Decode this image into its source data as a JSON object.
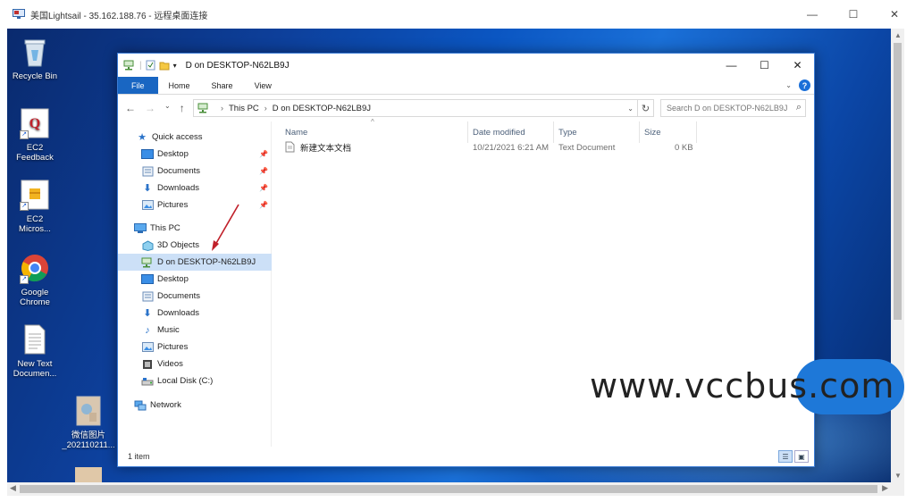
{
  "rdp": {
    "title": "美国Lightsail - 35.162.188.76 - 远程桌面连接",
    "minimize": "—",
    "maximize": "☐",
    "close": "✕"
  },
  "desktop_icons": [
    {
      "label_lines": [
        "Recycle Bin"
      ],
      "icon": "recycle-bin-icon"
    },
    {
      "label_lines": [
        "EC2",
        "Feedback"
      ],
      "icon": "feedback-icon"
    },
    {
      "label_lines": [
        "EC2",
        "Micros..."
      ],
      "icon": "package-icon"
    },
    {
      "label_lines": [
        "Google",
        "Chrome"
      ],
      "icon": "chrome-icon"
    },
    {
      "label_lines": [
        "New Text",
        "Documen..."
      ],
      "icon": "text-document-icon"
    },
    {
      "label_lines": [
        "微信图片",
        "_202110211..."
      ],
      "icon": "image-file-icon"
    }
  ],
  "explorer": {
    "title": "D on DESKTOP-N62LB9J",
    "ribbon_tabs": [
      "File",
      "Home",
      "Share",
      "View"
    ],
    "address": {
      "segments": [
        "This PC",
        "D on DESKTOP-N62LB9J"
      ]
    },
    "search_placeholder": "Search D on DESKTOP-N62LB9J",
    "nav": {
      "quick_access": "Quick access",
      "quick_items": [
        "Desktop",
        "Documents",
        "Downloads",
        "Pictures"
      ],
      "this_pc": "This PC",
      "pc_items": [
        "3D Objects",
        "D on DESKTOP-N62LB9J",
        "Desktop",
        "Documents",
        "Downloads",
        "Music",
        "Pictures",
        "Videos",
        "Local Disk (C:)"
      ],
      "network": "Network"
    },
    "columns": [
      "Name",
      "Date modified",
      "Type",
      "Size"
    ],
    "files": [
      {
        "name": "新建文本文档",
        "date": "10/21/2021 6:21 AM",
        "type": "Text Document",
        "size": "0 KB"
      }
    ],
    "status": "1 item"
  },
  "watermark": "www.vccbus.com",
  "colors": {
    "accent": "#1966c2",
    "selection": "#cce0f7",
    "annotation_arrow": "#c0202a"
  }
}
